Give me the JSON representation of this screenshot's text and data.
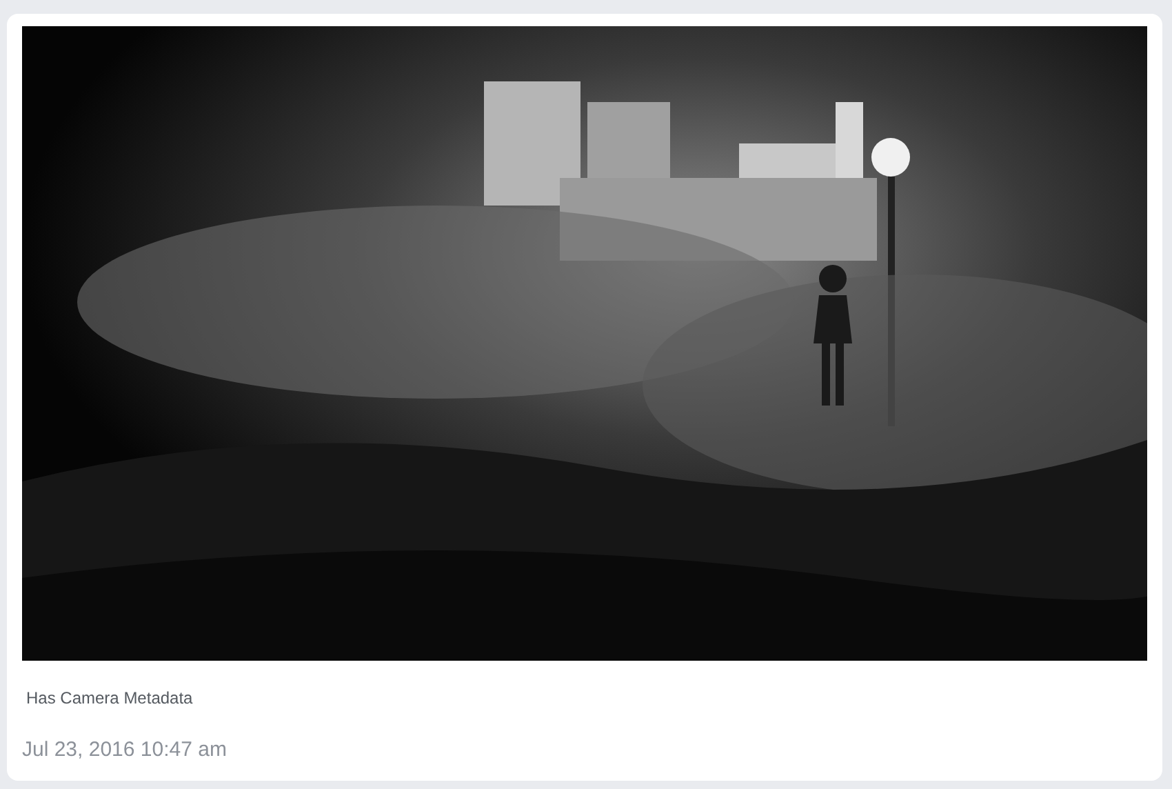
{
  "metadata_note": "Has Camera Metadata",
  "timestamp": "Jul 23, 2016 10:47 am"
}
